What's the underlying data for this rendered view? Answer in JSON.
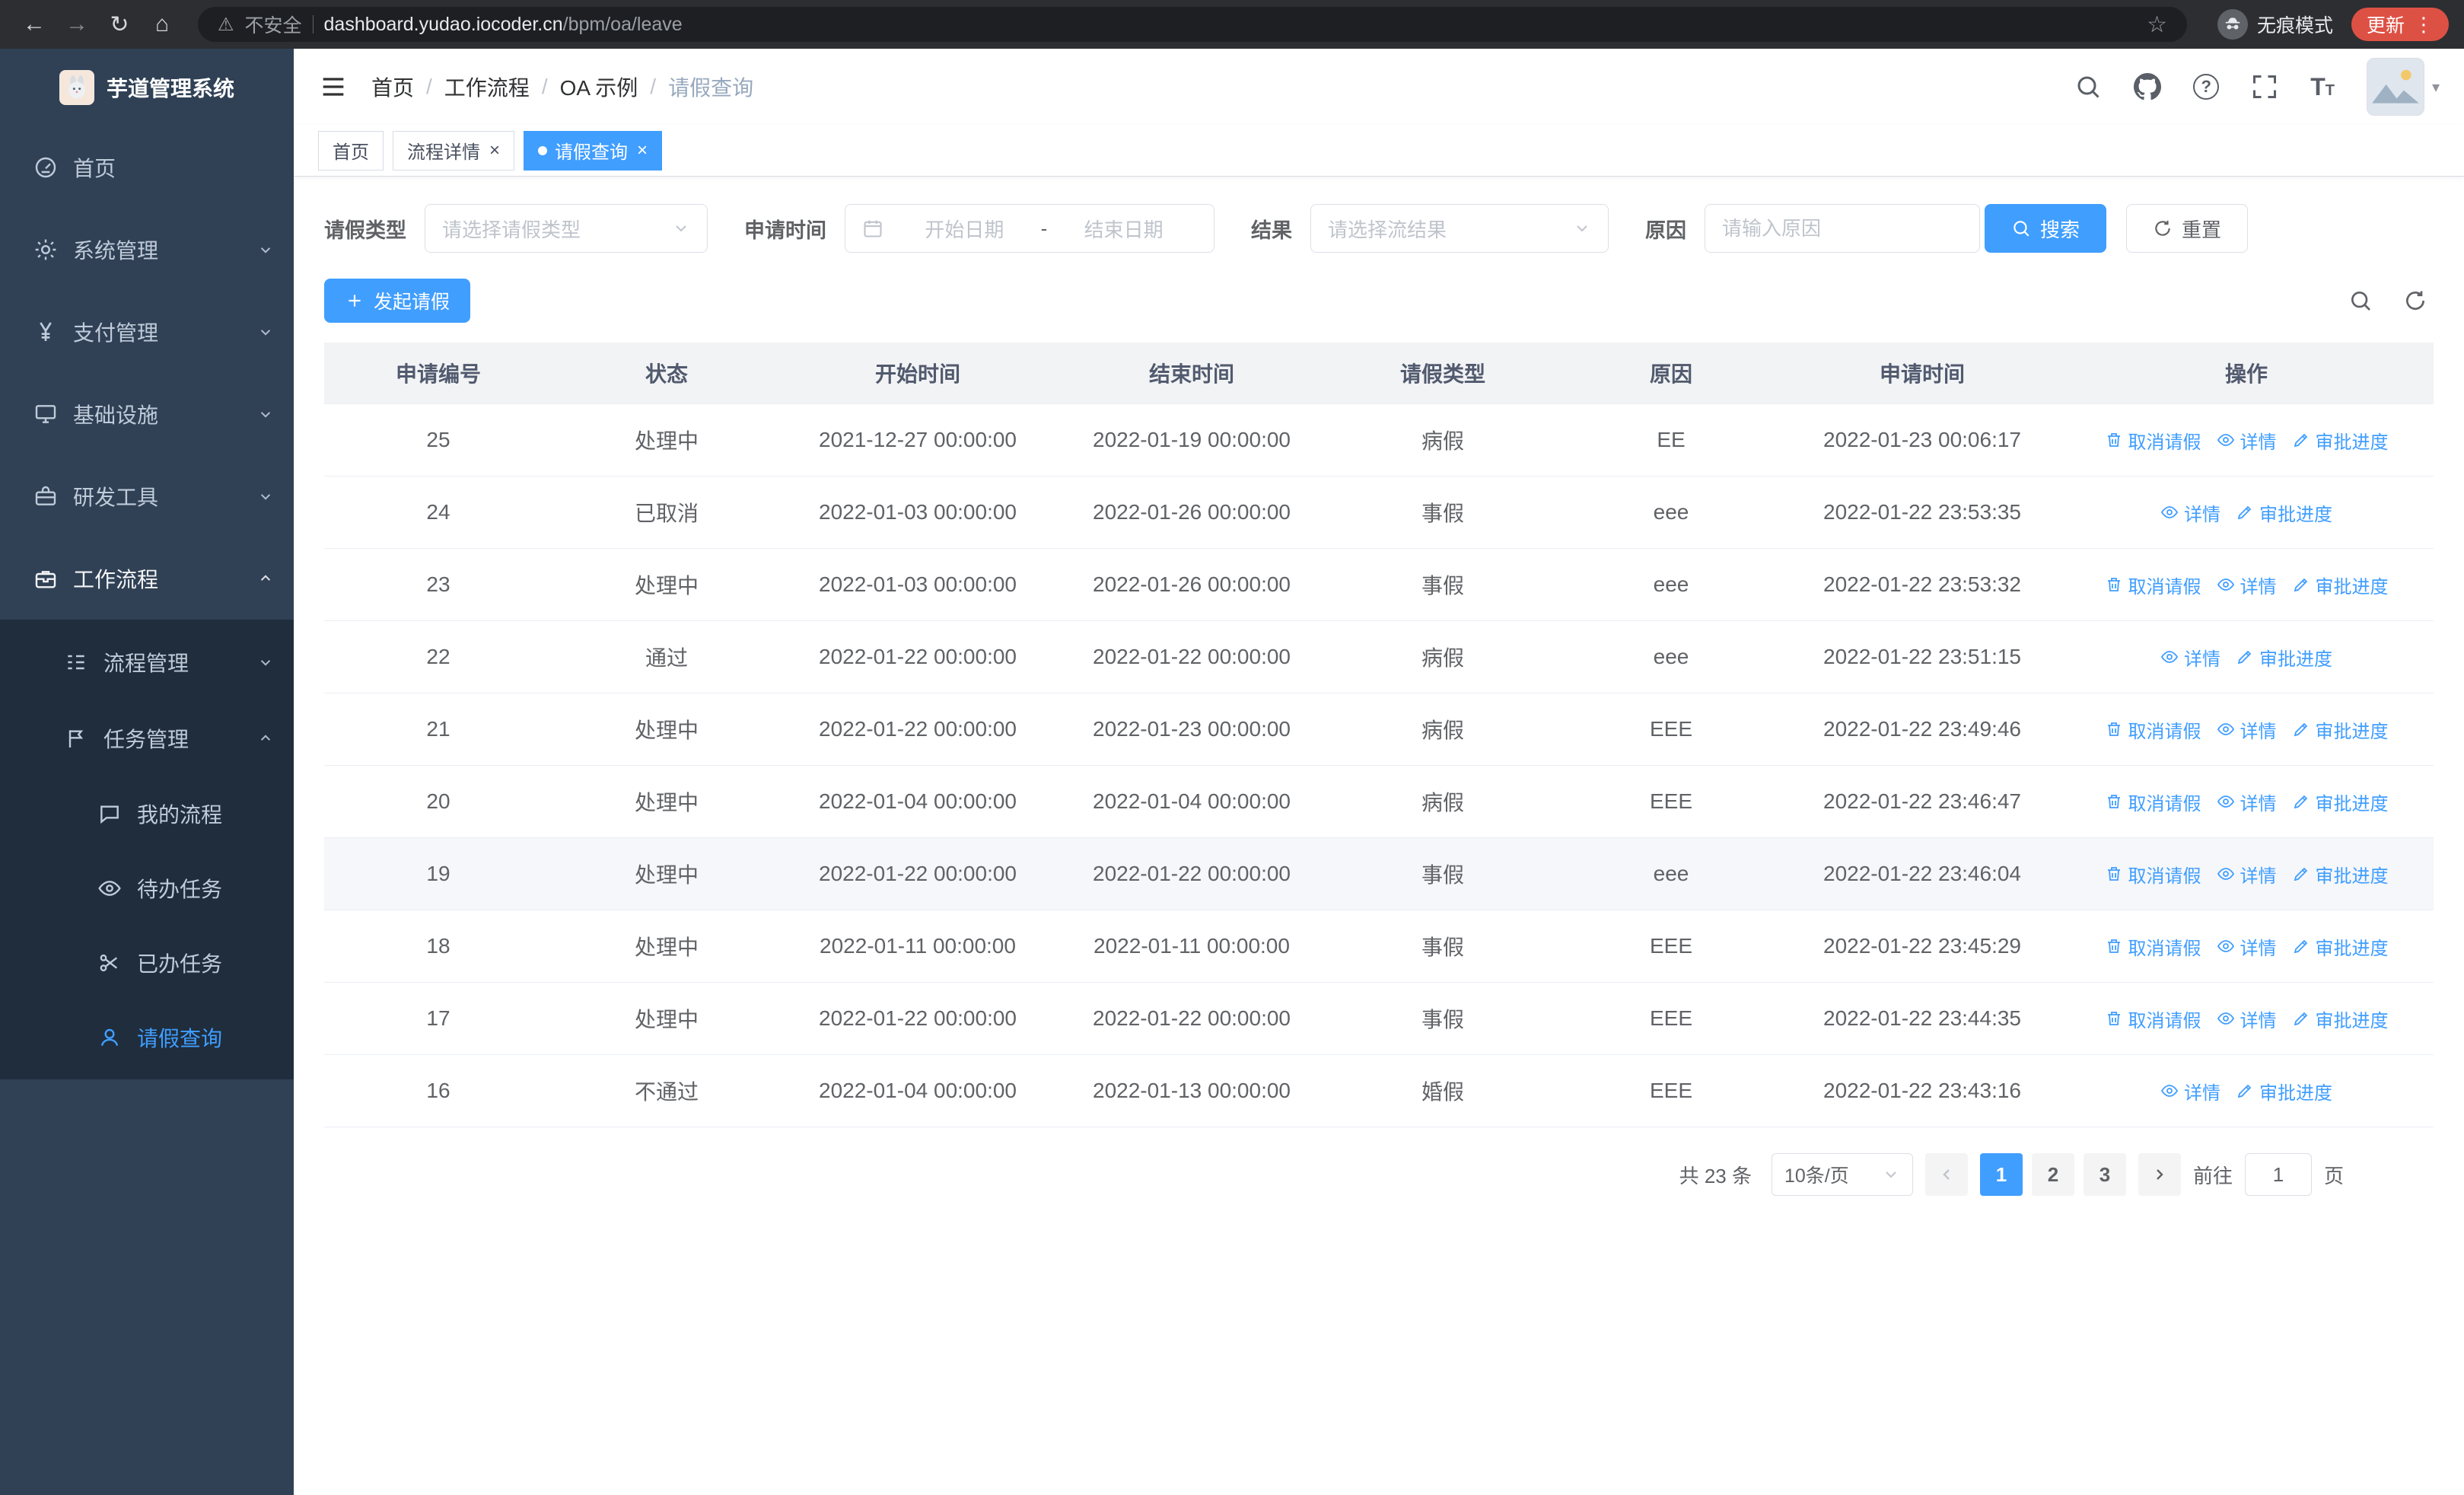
{
  "browser": {
    "security_label": "不安全",
    "url_domain": "dashboard.yudao.iocoder.cn",
    "url_path": "/bpm/oa/leave",
    "incognito_label": "无痕模式",
    "update_label": "更新"
  },
  "sidebar": {
    "title": "芋道管理系统",
    "items": {
      "home": "首页",
      "system": "系统管理",
      "payment": "支付管理",
      "infra": "基础设施",
      "devtools": "研发工具",
      "workflow": "工作流程",
      "process_mgmt": "流程管理",
      "task_mgmt": "任务管理",
      "my_process": "我的流程",
      "todo_tasks": "待办任务",
      "done_tasks": "已办任务",
      "leave_query": "请假查询"
    }
  },
  "navbar": {
    "breadcrumb": [
      "首页",
      "工作流程",
      "OA 示例",
      "请假查询"
    ]
  },
  "tabs": [
    {
      "label": "首页"
    },
    {
      "label": "流程详情",
      "closable": true
    },
    {
      "label": "请假查询",
      "closable": true,
      "active": true
    }
  ],
  "filters": {
    "leave_type_label": "请假类型",
    "leave_type_placeholder": "请选择请假类型",
    "apply_time_label": "申请时间",
    "date_start_placeholder": "开始日期",
    "date_separator": "-",
    "date_end_placeholder": "结束日期",
    "result_label": "结果",
    "result_placeholder": "请选择流结果",
    "reason_label": "原因",
    "reason_placeholder": "请输入原因",
    "search_label": "搜索",
    "reset_label": "重置"
  },
  "toolbar": {
    "create_label": "发起请假"
  },
  "table": {
    "columns": [
      "申请编号",
      "状态",
      "开始时间",
      "结束时间",
      "请假类型",
      "原因",
      "申请时间",
      "操作"
    ],
    "action_labels": {
      "cancel": "取消请假",
      "detail": "详情",
      "audit": "审批进度"
    },
    "rows": [
      {
        "id": "25",
        "status": "处理中",
        "start": "2021-12-27 00:00:00",
        "end": "2022-01-19 00:00:00",
        "type": "病假",
        "reason": "EE",
        "apply": "2022-01-23 00:06:17",
        "actions": [
          "cancel",
          "detail",
          "audit"
        ]
      },
      {
        "id": "24",
        "status": "已取消",
        "start": "2022-01-03 00:00:00",
        "end": "2022-01-26 00:00:00",
        "type": "事假",
        "reason": "eee",
        "apply": "2022-01-22 23:53:35",
        "actions": [
          "detail",
          "audit"
        ]
      },
      {
        "id": "23",
        "status": "处理中",
        "start": "2022-01-03 00:00:00",
        "end": "2022-01-26 00:00:00",
        "type": "事假",
        "reason": "eee",
        "apply": "2022-01-22 23:53:32",
        "actions": [
          "cancel",
          "detail",
          "audit"
        ]
      },
      {
        "id": "22",
        "status": "通过",
        "start": "2022-01-22 00:00:00",
        "end": "2022-01-22 00:00:00",
        "type": "病假",
        "reason": "eee",
        "apply": "2022-01-22 23:51:15",
        "actions": [
          "detail",
          "audit"
        ]
      },
      {
        "id": "21",
        "status": "处理中",
        "start": "2022-01-22 00:00:00",
        "end": "2022-01-23 00:00:00",
        "type": "病假",
        "reason": "EEE",
        "apply": "2022-01-22 23:49:46",
        "actions": [
          "cancel",
          "detail",
          "audit"
        ]
      },
      {
        "id": "20",
        "status": "处理中",
        "start": "2022-01-04 00:00:00",
        "end": "2022-01-04 00:00:00",
        "type": "病假",
        "reason": "EEE",
        "apply": "2022-01-22 23:46:47",
        "actions": [
          "cancel",
          "detail",
          "audit"
        ]
      },
      {
        "id": "19",
        "status": "处理中",
        "start": "2022-01-22 00:00:00",
        "end": "2022-01-22 00:00:00",
        "type": "事假",
        "reason": "eee",
        "apply": "2022-01-22 23:46:04",
        "actions": [
          "cancel",
          "detail",
          "audit"
        ],
        "highlighted": true
      },
      {
        "id": "18",
        "status": "处理中",
        "start": "2022-01-11 00:00:00",
        "end": "2022-01-11 00:00:00",
        "type": "事假",
        "reason": "EEE",
        "apply": "2022-01-22 23:45:29",
        "actions": [
          "cancel",
          "detail",
          "audit"
        ]
      },
      {
        "id": "17",
        "status": "处理中",
        "start": "2022-01-22 00:00:00",
        "end": "2022-01-22 00:00:00",
        "type": "事假",
        "reason": "EEE",
        "apply": "2022-01-22 23:44:35",
        "actions": [
          "cancel",
          "detail",
          "audit"
        ]
      },
      {
        "id": "16",
        "status": "不通过",
        "start": "2022-01-04 00:00:00",
        "end": "2022-01-13 00:00:00",
        "type": "婚假",
        "reason": "EEE",
        "apply": "2022-01-22 23:43:16",
        "actions": [
          "detail",
          "audit"
        ]
      }
    ]
  },
  "pagination": {
    "total": "共 23 条",
    "page_size": "10条/页",
    "pages": [
      "1",
      "2",
      "3"
    ],
    "active_index": 0,
    "goto_label": "前往",
    "goto_value": "1",
    "page_unit": "页"
  }
}
